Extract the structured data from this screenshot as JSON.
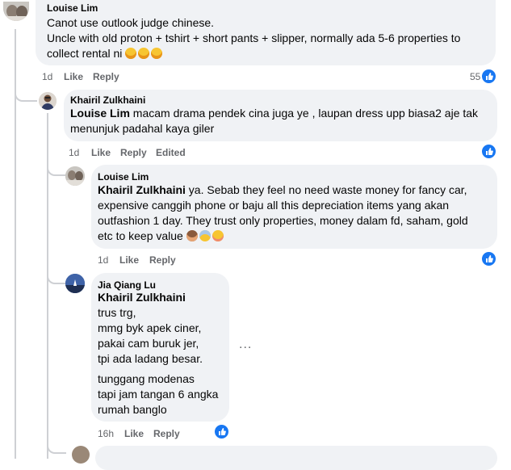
{
  "comments": [
    {
      "author": "Louise Lim",
      "lines": [
        "Canot use outlook judge chinese.",
        "Uncle with old proton + tshirt + short pants + slipper, normally ada 5-6 properties to"
      ],
      "last_line_text": "collect rental ni",
      "time": "1d",
      "like_label": "Like",
      "reply_label": "Reply",
      "reaction_count": "55"
    },
    {
      "author": "Khairil Zulkhaini",
      "mention": "Louise Lim",
      "first_line_rest": " macam drama pendek cina juga ye , laupan dress upp biasa2 aje tak",
      "lines": [
        "menunjuk padahal kaya giler"
      ],
      "time": "1d",
      "like_label": "Like",
      "reply_label": "Reply",
      "edited_label": "Edited"
    },
    {
      "author": "Louise Lim",
      "mention": "Khairil Zulkhaini",
      "first_line_rest": " ya. Sebab they feel no need waste money for fancy car,",
      "lines": [
        "expensive canggih phone or baju all this depreciation items yang akan",
        "outfashion 1 day. They trust only properties, money dalam fd, saham, gold"
      ],
      "last_line_text": "etc to keep value",
      "time": "1d",
      "like_label": "Like",
      "reply_label": "Reply"
    },
    {
      "author": "Jia Qiang Lu",
      "mention": "Khairil Zulkhaini",
      "lines": [
        "trus trg,",
        "mmg byk apek ciner,",
        "pakai cam buruk jer,",
        "tpi ada ladang besar.",
        "tunggang modenas",
        "tapi jam tangan 6 angka",
        "rumah banglo"
      ],
      "time": "16h",
      "like_label": "Like",
      "reply_label": "Reply",
      "more_label": "..."
    }
  ],
  "colors": {
    "bubble": "#f0f2f5",
    "like_blue": "#1877f2",
    "meta_text": "#65676b",
    "thread_line": "#ced0d4"
  },
  "icons": [
    "like-thumb-icon",
    "laughing-emoji-icon",
    "hear-no-evil-monkey-icon",
    "scream-emoji-icon",
    "flushed-emoji-icon",
    "more-options-icon"
  ]
}
